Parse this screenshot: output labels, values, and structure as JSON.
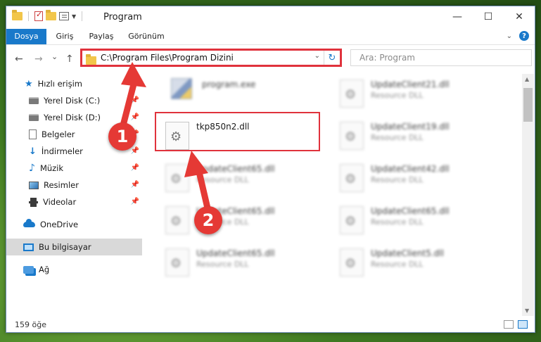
{
  "window": {
    "title": "Program",
    "controls": {
      "minimize": "—",
      "maximize": "☐",
      "close": "✕"
    }
  },
  "ribbon": {
    "tabs": [
      "Dosya",
      "Giriş",
      "Paylaş",
      "Görünüm"
    ],
    "expand_icon": "chevron-down-icon",
    "help_label": "?"
  },
  "navigation": {
    "back": "←",
    "forward": "→",
    "recent": "⌄",
    "up": "↑",
    "address": "C:\\Program Files\\Program Dizini",
    "refresh": "↻",
    "search_placeholder": "Ara: Program"
  },
  "sidebar": {
    "items": [
      {
        "label": "Hızlı erişim",
        "icon": "star-icon",
        "pinned": false
      },
      {
        "label": "Yerel Disk (C:)",
        "icon": "disk-icon",
        "pinned": true
      },
      {
        "label": "Yerel Disk (D:)",
        "icon": "disk-icon",
        "pinned": true
      },
      {
        "label": "Belgeler",
        "icon": "document-icon",
        "pinned": true
      },
      {
        "label": "İndirmeler",
        "icon": "download-icon",
        "pinned": true
      },
      {
        "label": "Müzik",
        "icon": "music-icon",
        "pinned": true
      },
      {
        "label": "Resimler",
        "icon": "pictures-icon",
        "pinned": true
      },
      {
        "label": "Videolar",
        "icon": "video-icon",
        "pinned": true
      },
      {
        "label": "OneDrive",
        "icon": "cloud-icon",
        "pinned": false
      },
      {
        "label": "Bu bilgisayar",
        "icon": "computer-icon",
        "pinned": false,
        "selected": true
      },
      {
        "label": "Ağ",
        "icon": "network-icon",
        "pinned": false
      }
    ]
  },
  "files": {
    "left_column": [
      {
        "name": "program.exe",
        "type": "",
        "blurred": true
      },
      {
        "name": "tkp850n2.dll",
        "type": "",
        "blurred": false,
        "highlighted": true
      },
      {
        "name": "UpdateClient65.dll",
        "type": "Resource DLL",
        "blurred": true
      },
      {
        "name": "UpdateClient65.dll",
        "type": "Resource DLL",
        "blurred": true
      },
      {
        "name": "UpdateClient65.dll",
        "type": "Resource DLL",
        "blurred": true
      }
    ],
    "right_column": [
      {
        "name": "UpdateClient21.dll",
        "type": "Resource DLL",
        "blurred": true
      },
      {
        "name": "UpdateClient19.dll",
        "type": "Resource DLL",
        "blurred": true
      },
      {
        "name": "UpdateClient42.dll",
        "type": "Resource DLL",
        "blurred": true
      },
      {
        "name": "UpdateClient65.dll",
        "type": "Resource DLL",
        "blurred": true
      },
      {
        "name": "UpdateClient5.dll",
        "type": "Resource DLL",
        "blurred": true
      }
    ]
  },
  "status": {
    "item_count": "159 öğe"
  },
  "annotations": {
    "marker_1": "1",
    "marker_2": "2",
    "color": "#e0323c"
  },
  "colors": {
    "accent": "#1979ca",
    "highlight": "#e0323c"
  }
}
